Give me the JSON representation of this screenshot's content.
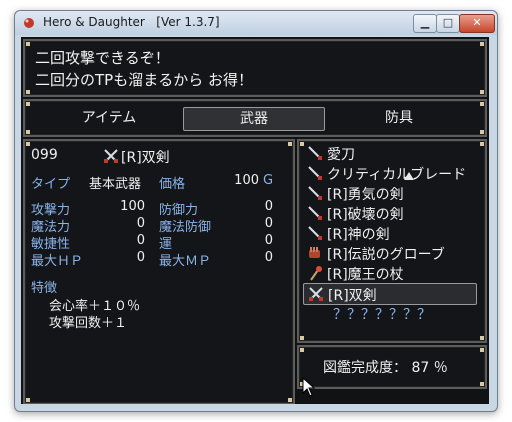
{
  "window": {
    "title": "Hero & Daughter   [Ver 1.3.7]"
  },
  "message": {
    "line1": "二回攻撃できるぞ！",
    "line2": "二回分のTPも溜まるから お得！"
  },
  "tabs": [
    {
      "label": "アイテム"
    },
    {
      "label": "武器"
    },
    {
      "label": "防具"
    }
  ],
  "detail": {
    "id": "099",
    "name": "[R]双剣",
    "type_label": "タイプ",
    "type_value": "基本武器",
    "price_label": "価格",
    "price_value": "100",
    "currency": "G",
    "stats": {
      "atk_label": "攻撃力",
      "atk": "100",
      "def_label": "防御力",
      "def": "0",
      "mat_label": "魔法力",
      "mat": "0",
      "mdf_label": "魔法防御",
      "mdf": "0",
      "agi_label": "敏捷性",
      "agi": "0",
      "luk_label": "運",
      "luk": "0",
      "mhp_label": "最大ＨＰ",
      "mhp": "0",
      "mmp_label": "最大ＭＰ",
      "mmp": "0"
    },
    "features_label": "特徴",
    "features": [
      "会心率＋１０％",
      "攻撃回数＋１"
    ]
  },
  "list": {
    "items": [
      {
        "label": "愛刀",
        "icon": "sword-icon"
      },
      {
        "label": "クリティカルブレード",
        "icon": "sword-icon"
      },
      {
        "label": "[R]勇気の剣",
        "icon": "sword-icon"
      },
      {
        "label": "[R]破壊の剣",
        "icon": "sword-icon"
      },
      {
        "label": "[R]神の剣",
        "icon": "sword-icon"
      },
      {
        "label": "[R]伝説のグローブ",
        "icon": "glove-icon"
      },
      {
        "label": "[R]魔王の杖",
        "icon": "staff-icon"
      },
      {
        "label": "[R]双剣",
        "icon": "dual-swords-icon"
      },
      {
        "label": "？？？？？？？",
        "icon": ""
      }
    ],
    "selected_index": 7
  },
  "completion": {
    "text": "図鑑完成度： 87 ％"
  },
  "colors": {
    "panel_bg": "#14161a",
    "text": "#f0f0f0",
    "system_blue": "#8ab4ea",
    "frame": "#5c5c5c"
  }
}
